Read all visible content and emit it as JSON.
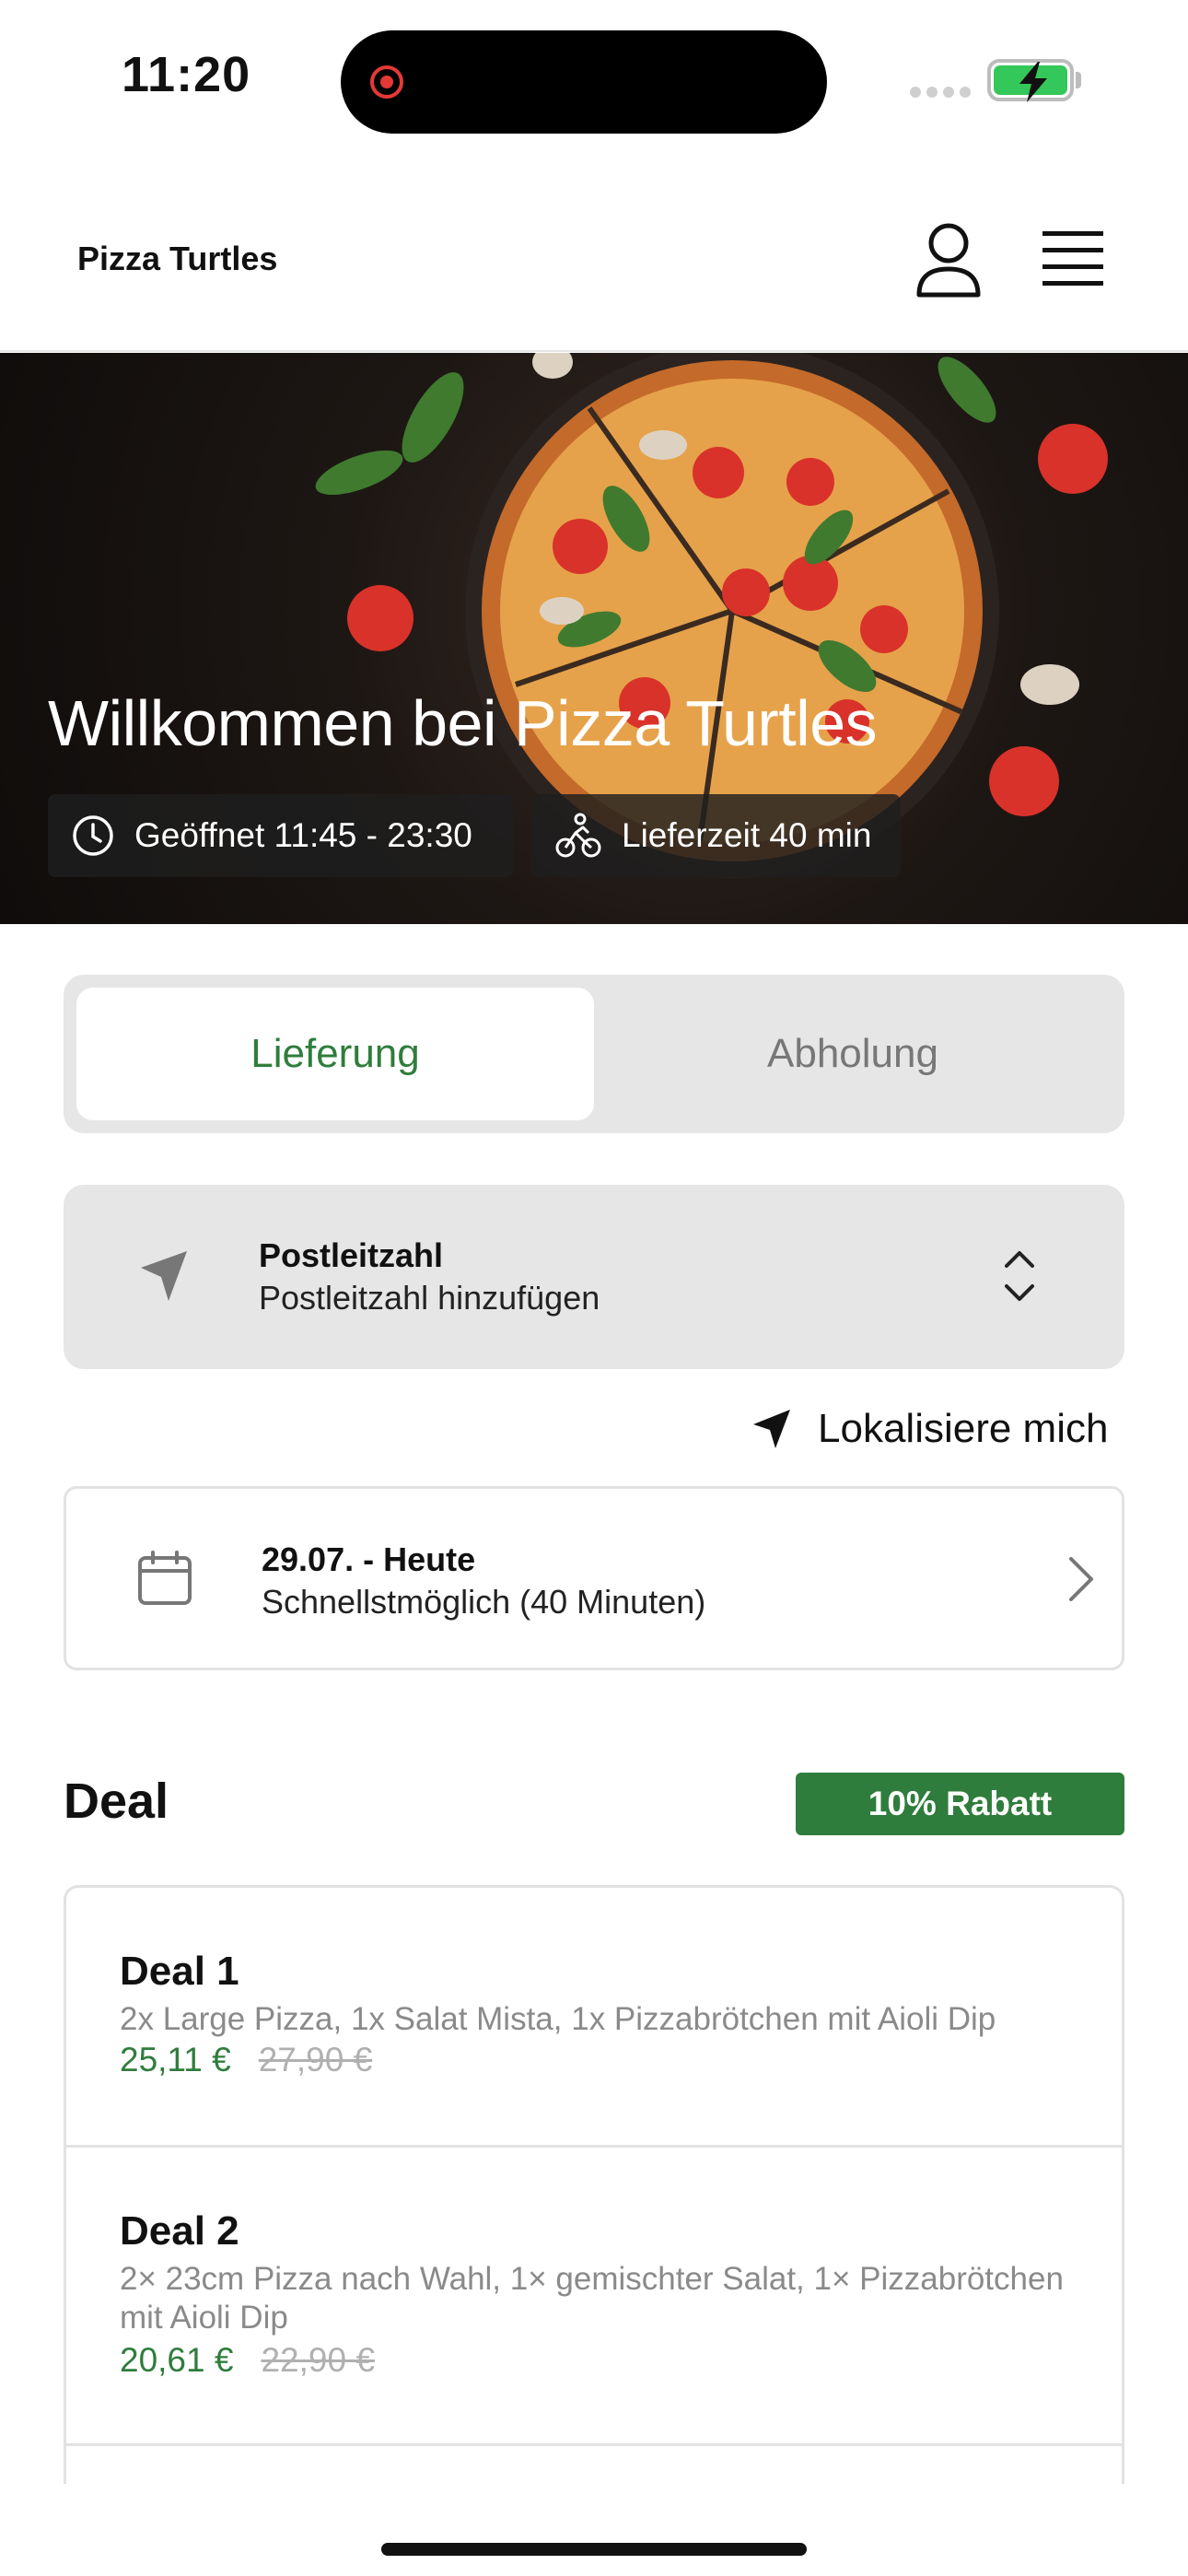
{
  "status_bar": {
    "time": "11:20"
  },
  "header": {
    "brand": "Pizza Turtles",
    "icons": {
      "account": "user-icon",
      "menu": "hamburger-menu-icon"
    }
  },
  "hero": {
    "title": "Willkommen bei Pizza Turtles",
    "opening_hours": "Geöffnet 11:45 - 23:30",
    "delivery_time": "Lieferzeit 40 min",
    "image": "pizza-on-dark-table-photo"
  },
  "order_mode": {
    "options": [
      "Lieferung",
      "Abholung"
    ],
    "selected": "Lieferung"
  },
  "postcode": {
    "label": "Postleitzahl",
    "placeholder": "Postleitzahl hinzufügen"
  },
  "locate": {
    "label": "Lokalisiere mich"
  },
  "schedule": {
    "date": "29.07. - Heute",
    "time": "Schnellstmöglich (40 Minuten)"
  },
  "deals_section": {
    "title": "Deal",
    "badge": "10% Rabatt",
    "items": [
      {
        "name": "Deal 1",
        "description": "2x Large Pizza, 1x Salat Mista, 1x Pizzabrötchen mit Aioli Dip",
        "price": "25,11 €",
        "old_price": "27,90 €"
      },
      {
        "name": "Deal 2",
        "description": "2× 23cm Pizza nach Wahl, 1× gemischter Salat, 1× Pizzabrötchen mit Aioli Dip",
        "price": "20,61 €",
        "old_price": "22,90 €"
      }
    ]
  },
  "colors": {
    "accent": "#2f7d3c",
    "panel": "#e6e6e6",
    "border": "#e2e2e2"
  }
}
